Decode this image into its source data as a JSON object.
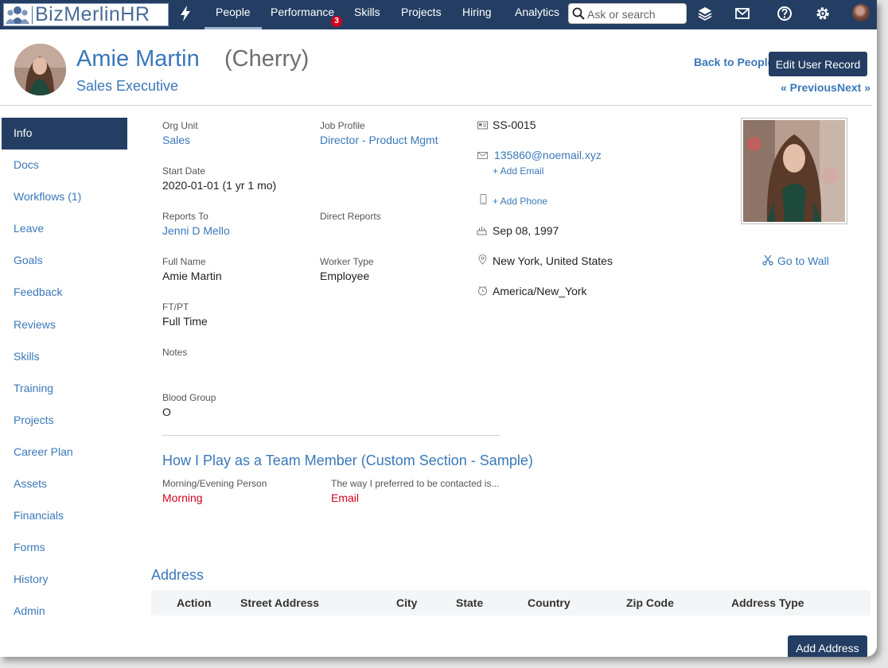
{
  "nav": {
    "brand": "BizMerlinHR",
    "links": [
      {
        "label": "People"
      },
      {
        "label": "Performance"
      },
      {
        "label": "Skills"
      },
      {
        "label": "Projects"
      },
      {
        "label": "Hiring"
      },
      {
        "label": "Analytics"
      }
    ],
    "performance_badge": "3",
    "search_placeholder": "Ask or search",
    "icons": [
      "bolt-icon",
      "search-icon",
      "layers-icon",
      "mail-icon",
      "help-icon",
      "gear-icon",
      "user-avatar"
    ]
  },
  "header": {
    "name": "Amie Martin",
    "nickname": "(Cherry)",
    "job_title": "Sales Executive",
    "back_link": "Back to People",
    "edit_button": "Edit User Record",
    "previous": "« Previous",
    "next": "Next »"
  },
  "sidebar": {
    "active": "Info",
    "items": [
      {
        "label": "Info"
      },
      {
        "label": "Docs"
      },
      {
        "label": "Workflows (1)"
      },
      {
        "label": "Leave"
      },
      {
        "label": "Goals"
      },
      {
        "label": "Feedback"
      },
      {
        "label": "Reviews"
      },
      {
        "label": "Skills"
      },
      {
        "label": "Training"
      },
      {
        "label": "Projects"
      },
      {
        "label": "Career Plan"
      },
      {
        "label": "Assets"
      },
      {
        "label": "Financials"
      },
      {
        "label": "Forms"
      },
      {
        "label": "History"
      },
      {
        "label": "Admin"
      }
    ]
  },
  "fields": {
    "org_unit": {
      "label": "Org Unit",
      "value": "Sales"
    },
    "job_profile": {
      "label": "Job Profile",
      "value": "Director - Product Mgmt"
    },
    "start_date": {
      "label": "Start Date",
      "value": "2020-01-01 (1 yr 1 mo)"
    },
    "reports_to": {
      "label": "Reports To",
      "value": "Jenni D Mello"
    },
    "direct_reports": {
      "label": "Direct Reports",
      "value": ""
    },
    "full_name": {
      "label": "Full Name",
      "value": "Amie Martin"
    },
    "worker_type": {
      "label": "Worker Type",
      "value": "Employee"
    },
    "ft_pt": {
      "label": "FT/PT",
      "value": "Full Time"
    },
    "notes": {
      "label": "Notes",
      "value": ""
    },
    "blood_group": {
      "label": "Blood Group",
      "value": "O"
    }
  },
  "custom_section": {
    "title": "How I Play as a Team Member (Custom Section - Sample)",
    "morning_evening": {
      "label": "Morning/Evening Person",
      "value": "Morning"
    },
    "contact_pref": {
      "label": "The way I preferred to be contacted is...",
      "value": "Email"
    }
  },
  "contact": {
    "employee_id": "SS-0015",
    "email": "135860@noemail.xyz",
    "add_email": "+ Add Email",
    "add_phone": "+ Add Phone",
    "birthday": "Sep 08, 1997",
    "location": "New York, United States",
    "timezone": "America/New_York"
  },
  "profile": {
    "go_to_wall": "Go to Wall"
  },
  "address": {
    "title": "Address",
    "columns": [
      "Action",
      "Street Address",
      "City",
      "State",
      "Country",
      "Zip Code",
      "Address Type"
    ],
    "add_button": "Add Address"
  },
  "colors": {
    "nav_bg": "#243e63",
    "link": "#3a78b9",
    "accent_red": "#d0021b"
  }
}
